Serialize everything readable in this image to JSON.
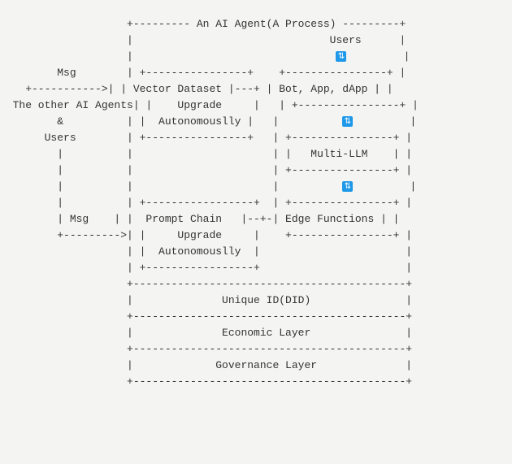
{
  "diagram": {
    "title": "An AI Agent(A Process)",
    "users_label": "Users",
    "arrow_icon": "⏫⏬",
    "left": {
      "msg1": "Msg",
      "msg1_line2": "The other AI Agents",
      "msg1_line3": "&",
      "msg1_line4": "Users",
      "msg2": "Msg"
    },
    "block_vector": {
      "line1": "Vector Dataset",
      "line2": "Upgrade",
      "line3": "Autonomouslly"
    },
    "block_right1": "Bot, App, dApp",
    "block_right2": "Multi-LLM",
    "block_prompt": {
      "line1": "Prompt Chain",
      "line2": "Upgrade",
      "line3": "Autonomouslly"
    },
    "block_right3": "Edge Functions",
    "bottom1": "Unique ID(DID)",
    "bottom2": "Economic Layer",
    "bottom3": "Governance Layer"
  }
}
